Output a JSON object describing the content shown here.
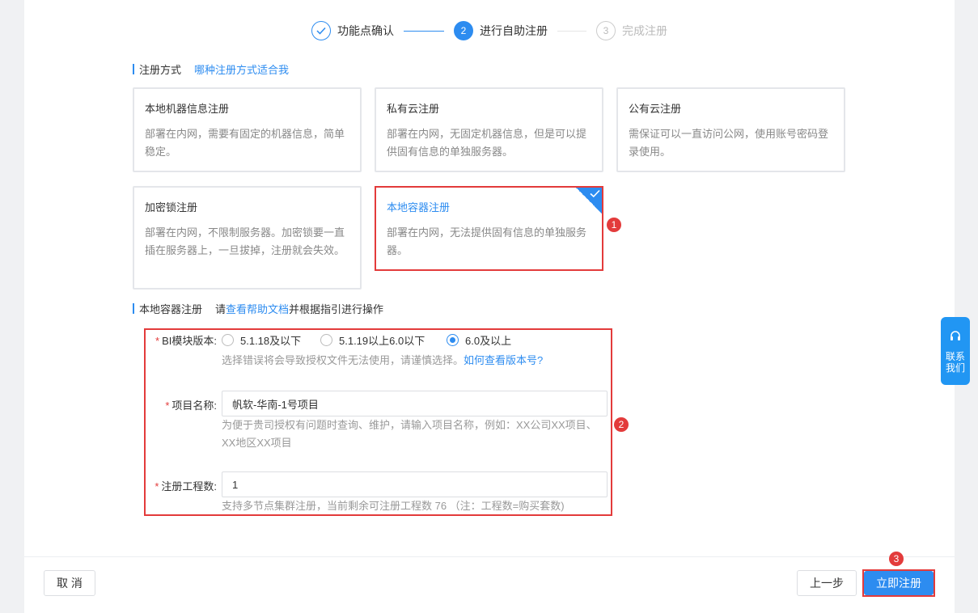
{
  "steps": [
    {
      "num": "",
      "label": "功能点确认"
    },
    {
      "num": "2",
      "label": "进行自助注册"
    },
    {
      "num": "3",
      "label": "完成注册"
    }
  ],
  "reg_method": {
    "title": "注册方式",
    "link": "哪种注册方式适合我"
  },
  "cards": [
    {
      "title": "本地机器信息注册",
      "desc": "部署在内网，需要有固定的机器信息，简单稳定。"
    },
    {
      "title": "私有云注册",
      "desc": "部署在内网，无固定机器信息，但是可以提供固有信息的单独服务器。"
    },
    {
      "title": "公有云注册",
      "desc": "需保证可以一直访问公网，使用账号密码登录使用。"
    },
    {
      "title": "加密锁注册",
      "desc": "部署在内网，不限制服务器。加密锁要一直插在服务器上，一旦拔掉，注册就会失效。"
    },
    {
      "title": "本地容器注册",
      "desc": "部署在内网，无法提供固有信息的单独服务器。"
    }
  ],
  "container_section": {
    "title": "本地容器注册",
    "prefix": "请",
    "link": "查看帮助文档",
    "suffix": "并根据指引进行操作"
  },
  "form": {
    "version_label": "BI模块版本:",
    "versions": [
      "5.1.18及以下",
      "5.1.19以上6.0以下",
      "6.0及以上"
    ],
    "selected_version_index": 2,
    "version_hint": "选择错误将会导致授权文件无法使用，请谨慎选择。",
    "version_hint_link": "如何查看版本号?",
    "project_label": "项目名称:",
    "project_value": "帆软-华南-1号项目",
    "project_hint": "为便于贵司授权有问题时查询、维护，请输入项目名称，例如：XX公司XX项目、XX地区XX项目",
    "count_label": "注册工程数:",
    "count_value": "1",
    "count_hint": "支持多节点集群注册，当前剩余可注册工程数 76 （注：工程数=购买套数)"
  },
  "badges": [
    "1",
    "2",
    "3"
  ],
  "footer": {
    "cancel": "取 消",
    "prev": "上一步",
    "submit": "立即注册"
  },
  "contact": {
    "line1": "联系",
    "line2": "我们"
  },
  "colors": {
    "primary": "#2d8cf0",
    "annotation": "#e33b3b"
  }
}
